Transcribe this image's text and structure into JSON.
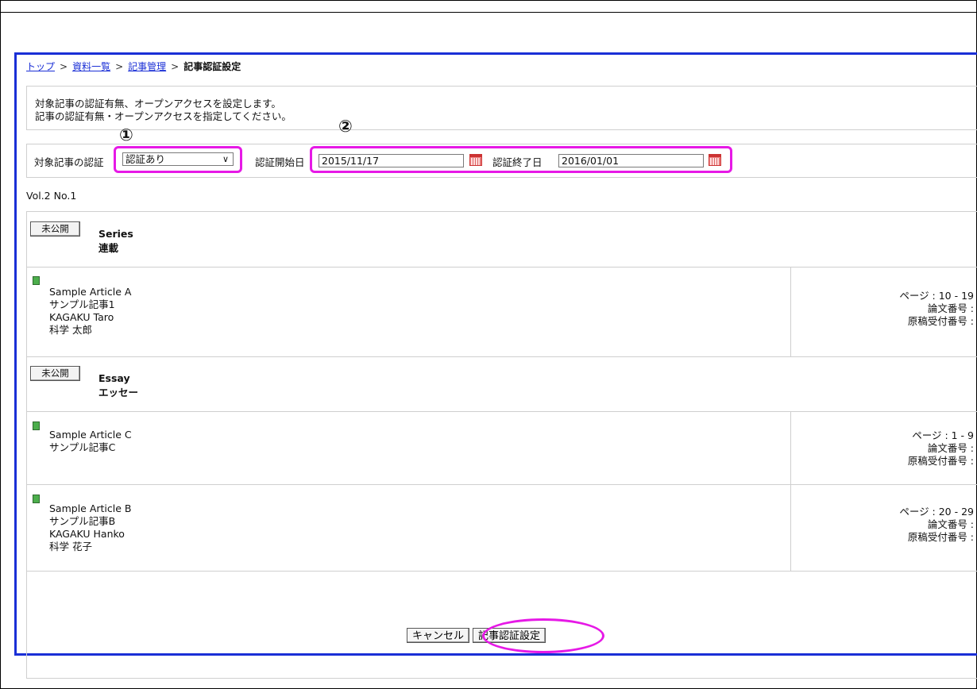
{
  "breadcrumb": {
    "top": "トップ",
    "sep1": ">",
    "list": "資料一覧",
    "sep2": ">",
    "manage": "記事管理",
    "sep3": ">",
    "current": "記事認証設定"
  },
  "info": {
    "line1": "対象記事の認証有無、オープンアクセスを設定します。",
    "line2": "記事の認証有無・オープンアクセスを指定してください。"
  },
  "filter": {
    "auth_label": "対象記事の認証",
    "auth_value": "認証あり",
    "start_label": "認証開始日",
    "start_value": "2015/11/17",
    "end_label": "認証終了日",
    "end_value": "2016/01/01"
  },
  "callouts": {
    "one": "①",
    "two": "②"
  },
  "volume": "Vol.2 No.1",
  "sections": [
    {
      "status": "未公開",
      "title_en": "Series",
      "title_ja": "連載",
      "articles": [
        {
          "lines": [
            "Sample Article A",
            "サンプル記事1",
            "KAGAKU Taro",
            "科学 太郎"
          ],
          "pages": "ページ : 10 - 19",
          "paper_no": "論文番号 :",
          "ms_no": "原稿受付番号 :"
        }
      ]
    },
    {
      "status": "未公開",
      "title_en": "Essay",
      "title_ja": "エッセー",
      "articles": [
        {
          "lines": [
            "Sample Article C",
            "サンプル記事C"
          ],
          "pages": "ページ : 1 - 9",
          "paper_no": "論文番号 :",
          "ms_no": "原稿受付番号 :"
        },
        {
          "lines": [
            "Sample Article B",
            "サンプル記事B",
            "KAGAKU Hanko",
            "科学 花子"
          ],
          "pages": "ページ : 20 - 29",
          "paper_no": "論文番号 :",
          "ms_no": "原稿受付番号 :"
        }
      ]
    }
  ],
  "buttons": {
    "cancel": "キャンセル",
    "submit": "記事認証設定"
  },
  "colors": {
    "frame": "#1a2fd6",
    "callout": "#e619e6",
    "link": "#1a2fd6"
  }
}
